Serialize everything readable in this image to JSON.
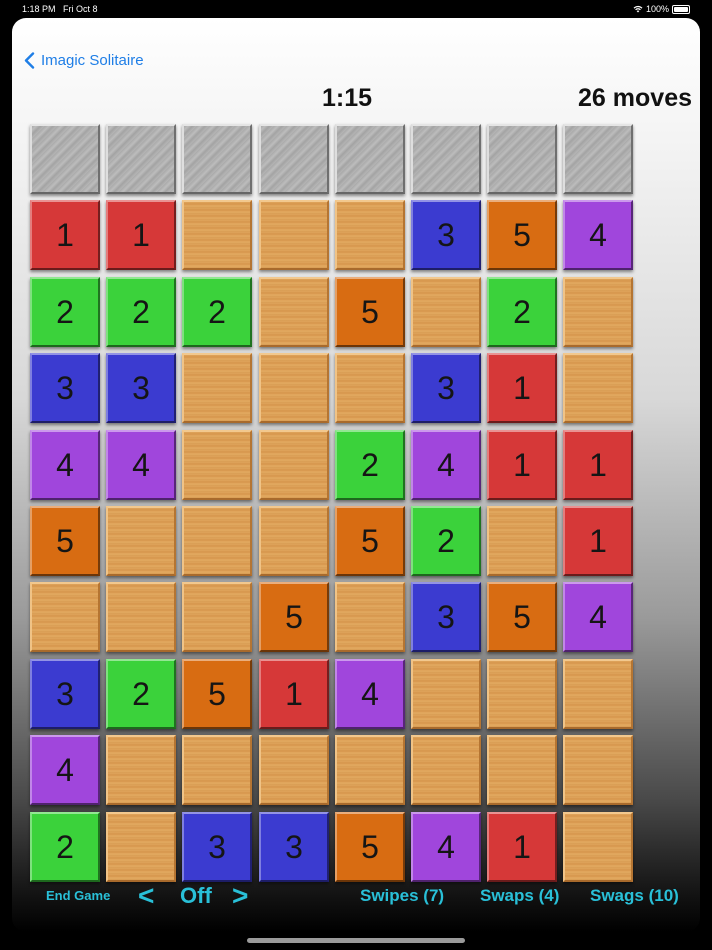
{
  "status_bar": {
    "time": "1:18 PM",
    "date": "Fri Oct 8",
    "battery": "100%"
  },
  "nav": {
    "back_label": "Imagic Solitaire"
  },
  "game": {
    "timer": "1:15",
    "moves": "26 moves"
  },
  "colors": {
    "1": "#d63838",
    "2": "#3bd23b",
    "3": "#3b3bd0",
    "4": "#a046dc",
    "5": "#d86c12"
  },
  "board": [
    [
      "W",
      "W",
      "W",
      "W",
      "W",
      "W",
      "W",
      "W"
    ],
    [
      "1",
      "1",
      "",
      "",
      "",
      "3",
      "5",
      "4"
    ],
    [
      "2",
      "2",
      "2",
      "",
      "5",
      "",
      "2",
      ""
    ],
    [
      "3",
      "3",
      "",
      "",
      "",
      "3",
      "1",
      ""
    ],
    [
      "4",
      "4",
      "",
      "",
      "2",
      "4",
      "1",
      "1"
    ],
    [
      "5",
      "",
      "",
      "",
      "5",
      "2",
      "",
      "1"
    ],
    [
      "",
      "",
      "",
      "5",
      "",
      "3",
      "5",
      "4"
    ],
    [
      "3",
      "2",
      "5",
      "1",
      "4",
      "",
      "",
      ""
    ],
    [
      "4",
      "",
      "",
      "",
      "",
      "",
      "",
      ""
    ],
    [
      "2",
      "",
      "3",
      "3",
      "5",
      "4",
      "1",
      ""
    ]
  ],
  "controls": {
    "end_game": "End Game",
    "prev": "<",
    "mode": "Off",
    "next": ">",
    "swipes": "Swipes (7)",
    "swaps": "Swaps (4)",
    "swags": "Swags (10)"
  }
}
